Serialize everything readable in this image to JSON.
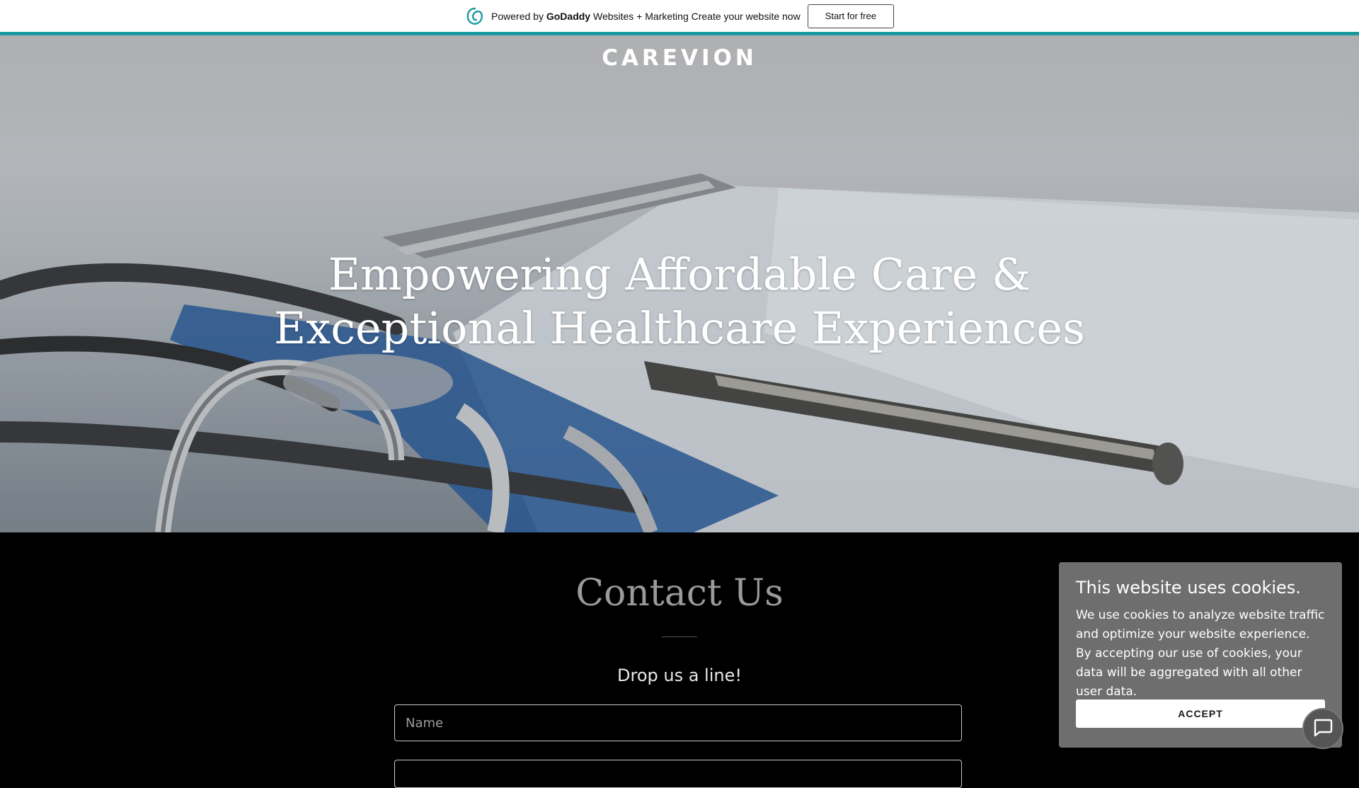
{
  "promo_bar": {
    "powered_by": "Powered by",
    "brand": "GoDaddy",
    "tagline": "Websites + Marketing Create your website now",
    "start_button": "Start for free",
    "accent_color": "#1a9aa0"
  },
  "header": {
    "site_name": "CAREVION"
  },
  "hero": {
    "headline_line1": "Empowering Affordable Care &",
    "headline_line2": "Exceptional Healthcare Experiences",
    "background_image": "stethoscope-and-pen-on-clipboard"
  },
  "contact": {
    "title": "Contact Us",
    "subtitle": "Drop us a line!",
    "name_placeholder": "Name"
  },
  "cookie_banner": {
    "title": "This website uses cookies.",
    "body": "We use cookies to analyze website traffic and optimize your website experience. By accepting our use of cookies, your data will be aggregated with all other user data.",
    "accept_label": "ACCEPT"
  },
  "chat_widget": {
    "icon": "chat-bubble-icon"
  }
}
